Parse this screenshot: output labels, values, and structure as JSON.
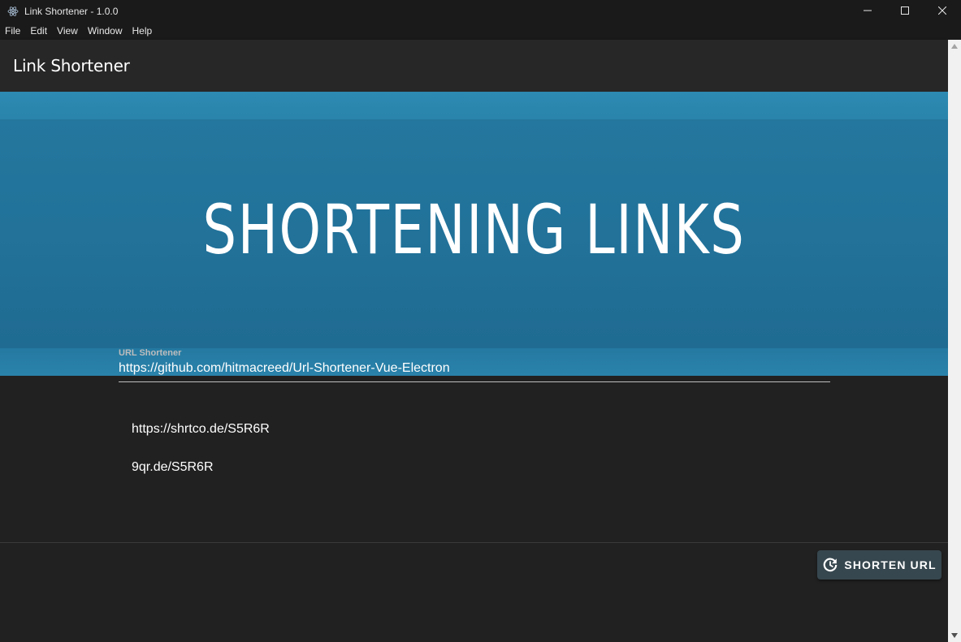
{
  "window": {
    "title": "Link Shortener - 1.0.0",
    "icon": "electron-icon",
    "controls": [
      "minimize-icon",
      "maximize-icon",
      "close-icon"
    ]
  },
  "menu": {
    "items": [
      "File",
      "Edit",
      "View",
      "Window",
      "Help"
    ]
  },
  "app_bar": {
    "title": "Link Shortener"
  },
  "banner": {
    "text": "SHORTENING LINKS",
    "color": "#24779e"
  },
  "form": {
    "label": "URL Shortener",
    "value": "https://github.com/hitmacreed/Url-Shortener-Vue-Electron"
  },
  "results": [
    "https://shrtco.de/S5R6R",
    "9qr.de/S5R6R"
  ],
  "actions": {
    "shorten_label": "SHORTEN URL",
    "shorten_icon": "refresh-icon",
    "button_color": "#37474f"
  }
}
